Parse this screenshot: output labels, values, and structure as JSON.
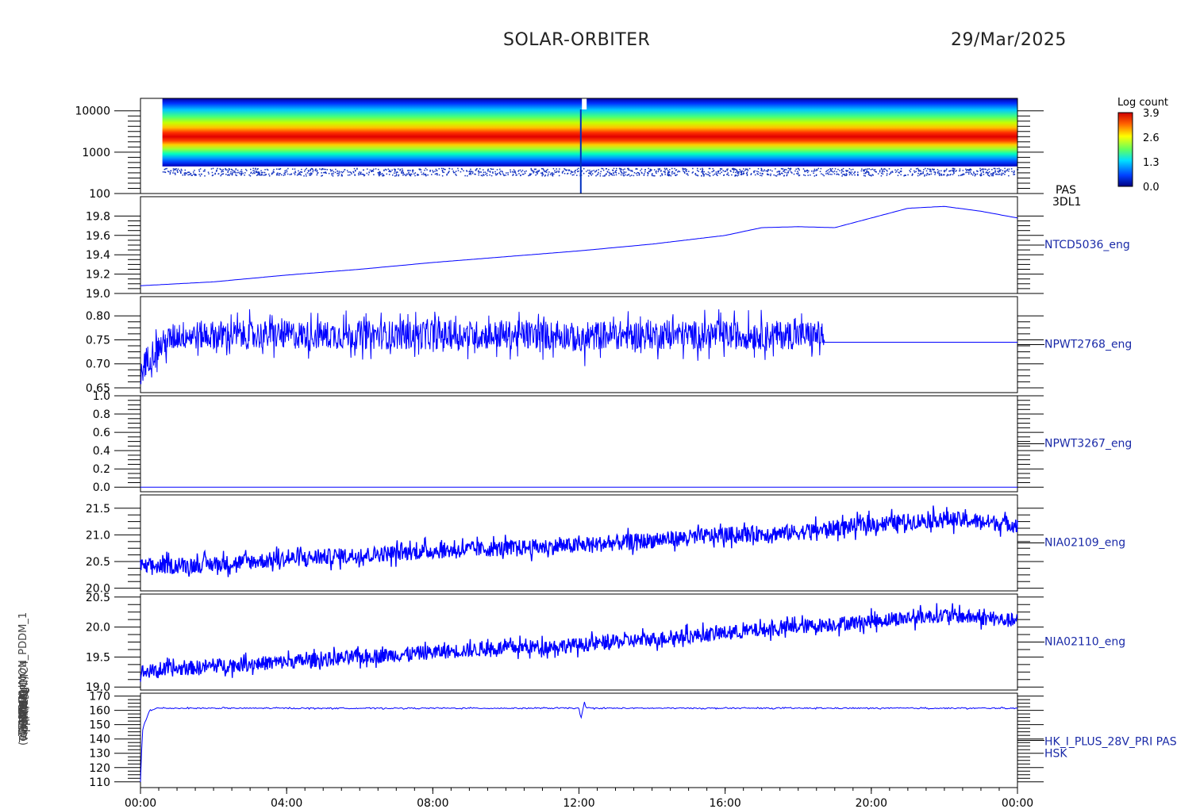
{
  "header": {
    "title": "SOLAR-ORBITER",
    "date": "29/Mar/2025"
  },
  "colors": {
    "trace": "#0000ff",
    "axis": "#000000",
    "label": "#1a2aa8"
  },
  "ylabels": [
    "(eV)",
    "Temp (DegC)",
    "Approx",
    "TEMP (A)",
    "RPW FM",
    "ANT 1",
    "ANT 3",
    "RPW",
    "(V)",
    "(deg)",
    "(mA)",
    "THERMC4",
    "HK_IMON_PDDM_1"
  ],
  "chart_data": [
    {
      "type": "heatmap",
      "panel": "PAS 3DL1",
      "label": "PAS\n3DL1",
      "label_lines": [
        "PAS",
        "3DL1"
      ],
      "yscale": "log",
      "ylim": [
        100,
        20000
      ],
      "yticks": [
        "10000",
        "1000",
        "100"
      ],
      "colorbar": {
        "title": "Log count",
        "ticks": [
          "3.9",
          "2.6",
          "1.3",
          "0.0"
        ],
        "range": [
          0.0,
          3.9
        ]
      },
      "peak_energy_ev": 2000
    },
    {
      "type": "line",
      "label": "NTCD5036_eng",
      "ylim": [
        19.0,
        20.0
      ],
      "yticks": [
        "19.8",
        "19.6",
        "19.4",
        "19.2",
        "19.0"
      ],
      "x": [
        0,
        2,
        4,
        6,
        8,
        10,
        12,
        14,
        16,
        17,
        18,
        19,
        20,
        21,
        22,
        23,
        24
      ],
      "values": [
        19.08,
        19.12,
        19.19,
        19.25,
        19.32,
        19.38,
        19.44,
        19.51,
        19.6,
        19.68,
        19.69,
        19.68,
        19.78,
        19.88,
        19.9,
        19.85,
        19.78
      ]
    },
    {
      "type": "line",
      "label": "NPWT2768_eng",
      "ylim": [
        0.64,
        0.84
      ],
      "yticks": [
        "0.80",
        "0.75",
        "0.70",
        "0.65"
      ],
      "x": [
        0,
        0.1,
        0.3,
        0.6,
        1,
        6,
        11.7,
        12.1,
        12.5,
        18.7,
        18.71,
        24
      ],
      "values": [
        0.665,
        0.7,
        0.72,
        0.74,
        0.76,
        0.76,
        0.76,
        0.745,
        0.76,
        0.76,
        0.745,
        0.745
      ],
      "noise_until_hour": 18.7,
      "noise_amplitude": 0.03
    },
    {
      "type": "line",
      "label": "NPWT3267_eng",
      "ylim": [
        -0.05,
        1.0
      ],
      "yticks": [
        "1.0",
        "0.8",
        "0.6",
        "0.4",
        "0.2",
        "0.0"
      ],
      "x": [
        0,
        24
      ],
      "values": [
        0.0,
        0.0
      ]
    },
    {
      "type": "line",
      "label": "NIA02109_eng",
      "ylim": [
        19.95,
        21.75
      ],
      "yticks": [
        "21.5",
        "21.0",
        "20.5",
        "20.0"
      ],
      "x": [
        0,
        2,
        4,
        6,
        8,
        10,
        12,
        14,
        16,
        18,
        20,
        22,
        24
      ],
      "values": [
        20.4,
        20.45,
        20.55,
        20.62,
        20.7,
        20.75,
        20.8,
        20.9,
        21.0,
        21.05,
        21.2,
        21.3,
        21.2
      ],
      "noise_amplitude": 0.15
    },
    {
      "type": "line",
      "label": "NIA02110_eng",
      "ylim": [
        18.95,
        20.55
      ],
      "yticks": [
        "20.5",
        "20.0",
        "19.5",
        "19.0"
      ],
      "x": [
        0,
        2,
        4,
        6,
        8,
        10,
        12,
        14,
        16,
        18,
        20,
        22,
        24
      ],
      "values": [
        19.25,
        19.35,
        19.42,
        19.5,
        19.58,
        19.65,
        19.7,
        19.8,
        19.9,
        20.0,
        20.1,
        20.2,
        20.1
      ],
      "noise_amplitude": 0.12
    },
    {
      "type": "line",
      "label": "HK_I_PLUS_28V_PRI PAS\nHSK",
      "label_lines": [
        "HK_I_PLUS_28V_PRI PAS",
        "HSK"
      ],
      "ylim": [
        106,
        172
      ],
      "yticks": [
        "170",
        "160",
        "150",
        "140",
        "130",
        "120",
        "110"
      ],
      "x": [
        0,
        0.05,
        0.1,
        0.25,
        0.45,
        12.0,
        12.05,
        12.15,
        12.2,
        24
      ],
      "values": [
        110,
        145,
        150,
        160,
        161.5,
        161.5,
        153,
        166,
        161.5,
        161.5
      ]
    }
  ],
  "xaxis": {
    "range_hours": [
      0,
      24
    ],
    "ticks": [
      "00:00",
      "04:00",
      "08:00",
      "12:00",
      "16:00",
      "20:00",
      "00:00"
    ]
  }
}
